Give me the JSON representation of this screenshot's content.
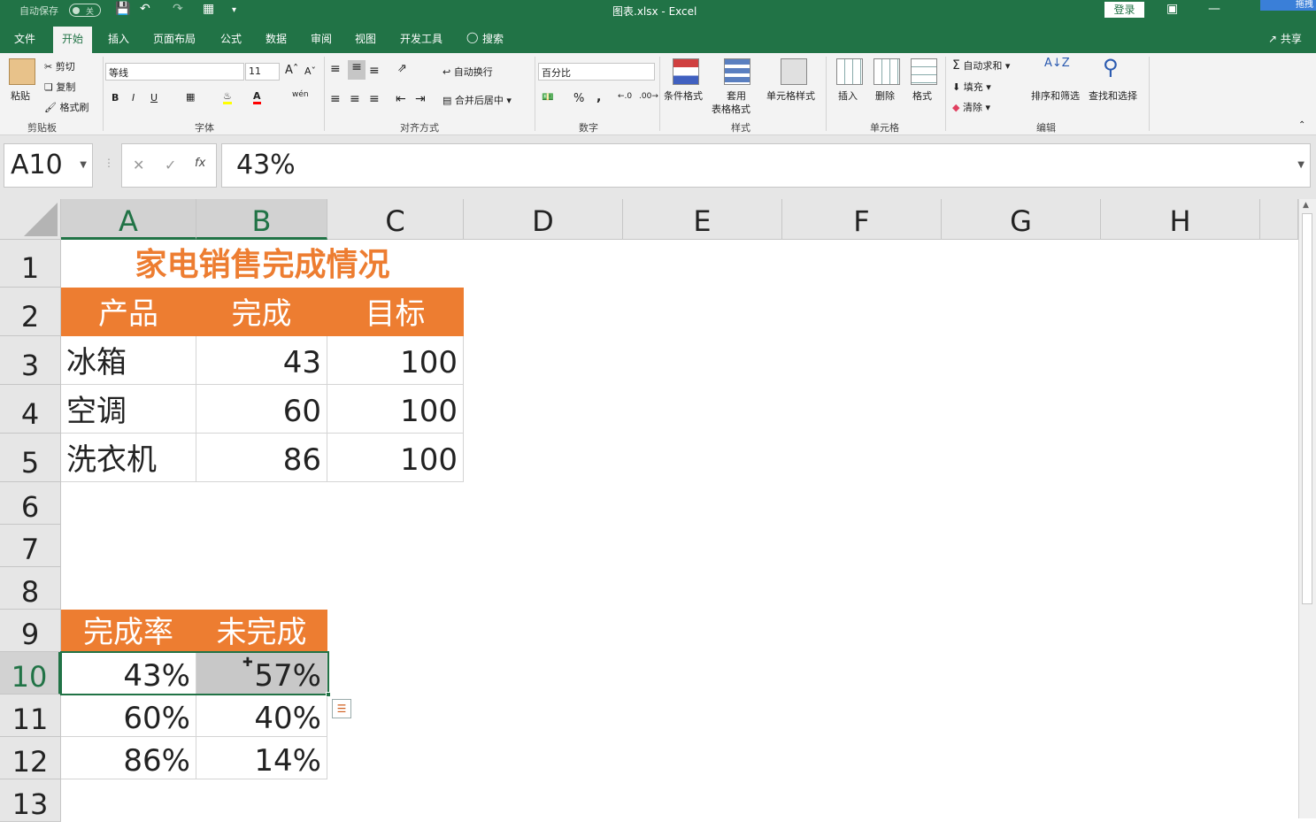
{
  "titlebar": {
    "autosave_label": "自动保存",
    "autosave_state": "关",
    "doc_title": "图表.xlsx - Excel",
    "login_label": "登录",
    "corner_label": "拖拽"
  },
  "tabs": [
    "文件",
    "开始",
    "插入",
    "页面布局",
    "公式",
    "数据",
    "审阅",
    "视图",
    "开发工具"
  ],
  "active_tab": "开始",
  "search_label": "搜索",
  "share_label": "共享",
  "ribbon": {
    "clipboard": {
      "paste": "粘贴",
      "cut": "剪切",
      "copy": "复制",
      "format_painter": "格式刷",
      "label": "剪贴板"
    },
    "font": {
      "name": "等线",
      "size": "11",
      "label": "字体",
      "bold": "B",
      "italic": "I",
      "underline": "U",
      "phonetic": "wén"
    },
    "alignment": {
      "wrap": "自动换行",
      "merge": "合并后居中",
      "label": "对齐方式"
    },
    "number": {
      "format": "百分比",
      "percent": "%",
      "comma": ",",
      "label": "数字"
    },
    "styles": {
      "conditional": "条件格式",
      "table_1": "套用",
      "table_2": "表格格式",
      "cell_styles": "单元格样式",
      "label": "样式"
    },
    "cells": {
      "insert": "插入",
      "delete": "删除",
      "format": "格式",
      "label": "单元格"
    },
    "editing": {
      "autosum": "自动求和",
      "fill": "填充",
      "clear": "清除",
      "sort": "排序和筛选",
      "find": "查找和选择",
      "label": "编辑"
    }
  },
  "formula_bar": {
    "name_box": "A10",
    "fx": "fx",
    "value": "43%"
  },
  "columns": [
    "A",
    "B",
    "C",
    "D",
    "E",
    "F",
    "G",
    "H"
  ],
  "rows": [
    "1",
    "2",
    "3",
    "4",
    "5",
    "6",
    "7",
    "8",
    "9",
    "10",
    "11",
    "12",
    "13"
  ],
  "sheet": {
    "title": "家电销售完成情况",
    "table1_headers": [
      "产品",
      "完成",
      "目标"
    ],
    "table1_rows": [
      [
        "冰箱",
        "43",
        "100"
      ],
      [
        "空调",
        "60",
        "100"
      ],
      [
        "洗衣机",
        "86",
        "100"
      ]
    ],
    "table2_headers": [
      "完成率",
      "未完成"
    ],
    "table2_rows": [
      [
        "43%",
        "57%"
      ],
      [
        "60%",
        "40%"
      ],
      [
        "86%",
        "14%"
      ]
    ]
  },
  "colors": {
    "excel_green": "#217346",
    "header_orange": "#ed7d31"
  }
}
